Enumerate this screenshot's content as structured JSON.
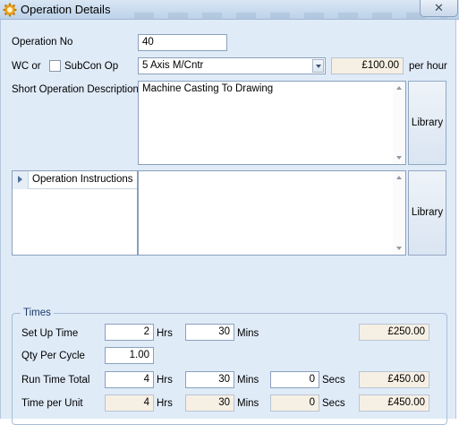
{
  "window": {
    "title": "Operation Details",
    "close_glyph": "✕",
    "icon": "gear-app-icon"
  },
  "form": {
    "operation_no": {
      "label": "Operation No",
      "value": "40"
    },
    "wc": {
      "label": "WC or",
      "subcon_label": "SubCon Op",
      "subcon_checked": false,
      "work_centre": "5 Axis M/Cntr",
      "rate": "£100.00",
      "rate_unit": "per hour"
    },
    "short_description": {
      "label": "Short Operation Description",
      "value": "Machine Casting To Drawing"
    },
    "library_label": "Library",
    "instructions": {
      "header": "Operation Instructions",
      "value": ""
    }
  },
  "times": {
    "group_label": "Times",
    "units": {
      "hrs": "Hrs",
      "mins": "Mins",
      "secs": "Secs"
    },
    "setup": {
      "label": "Set Up Time",
      "hrs": "2",
      "mins": "30",
      "cost": "£250.00"
    },
    "qty_per_cycle": {
      "label": "Qty Per Cycle",
      "value": "1.00"
    },
    "run_total": {
      "label": "Run Time Total",
      "hrs": "4",
      "mins": "30",
      "secs": "0",
      "cost": "£450.00"
    },
    "per_unit": {
      "label": "Time per Unit",
      "hrs": "4",
      "mins": "30",
      "secs": "0",
      "cost": "£450.00"
    }
  },
  "colors": {
    "panel_bg": "#e0ebf8",
    "readonly_bg": "#f6f0e4",
    "accent": "#1d3b6b"
  }
}
